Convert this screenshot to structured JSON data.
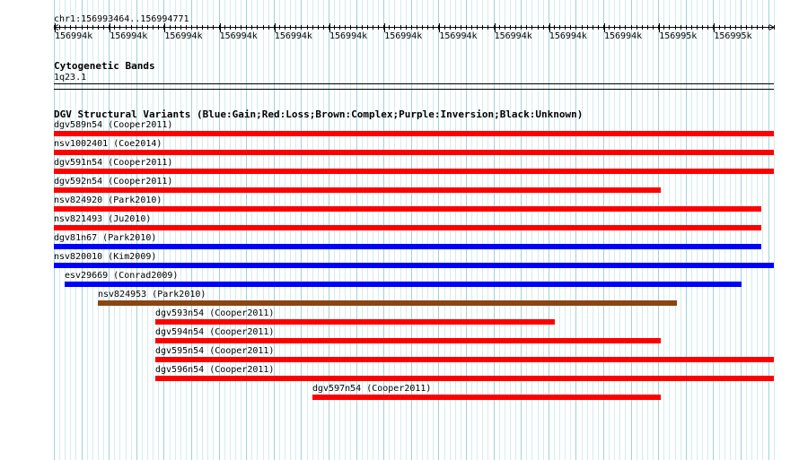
{
  "ruler": {
    "location": "chr1:156993464..156994771",
    "tick_labels": [
      "156994k",
      "156994k",
      "156994k",
      "156994k",
      "156994k",
      "156994k",
      "156994k",
      "156994k",
      "156994k",
      "156994k",
      "156994k",
      "156995k",
      "156995k"
    ]
  },
  "cytoband_track": {
    "title": "Cytogenetic Bands",
    "band": "1q23.1"
  },
  "dgv_track": {
    "title": "DGV Structural Variants (Blue:Gain;Red:Loss;Brown:Complex;Purple:Inversion;Black:Unknown)",
    "type_colors": {
      "loss": "#ff0000",
      "gain": "#0000ff",
      "complex": "#8b4513"
    },
    "variants": [
      {
        "id": "dgv589n54",
        "study": "(Cooper2011)",
        "type": "loss"
      },
      {
        "id": "nsv1002401",
        "study": "(Coe2014)",
        "type": "loss"
      },
      {
        "id": "dgv591n54",
        "study": "(Cooper2011)",
        "type": "loss"
      },
      {
        "id": "dgv592n54",
        "study": "(Cooper2011)",
        "type": "loss"
      },
      {
        "id": "nsv824920",
        "study": "(Park2010)",
        "type": "loss"
      },
      {
        "id": "nsv821493",
        "study": "(Ju2010)",
        "type": "loss"
      },
      {
        "id": "dgv81n67",
        "study": "(Park2010)",
        "type": "gain"
      },
      {
        "id": "nsv820010",
        "study": "(Kim2009)",
        "type": "gain"
      },
      {
        "id": "esv29669",
        "study": "(Conrad2009)",
        "type": "gain"
      },
      {
        "id": "nsv824953",
        "study": "(Park2010)",
        "type": "complex"
      },
      {
        "id": "dgv593n54",
        "study": "(Cooper2011)",
        "type": "loss"
      },
      {
        "id": "dgv594n54",
        "study": "(Cooper2011)",
        "type": "loss"
      },
      {
        "id": "dgv595n54",
        "study": "(Cooper2011)",
        "type": "loss"
      },
      {
        "id": "dgv596n54",
        "study": "(Cooper2011)",
        "type": "loss"
      },
      {
        "id": "dgv597n54",
        "study": "(Cooper2011)",
        "type": "loss"
      }
    ]
  }
}
